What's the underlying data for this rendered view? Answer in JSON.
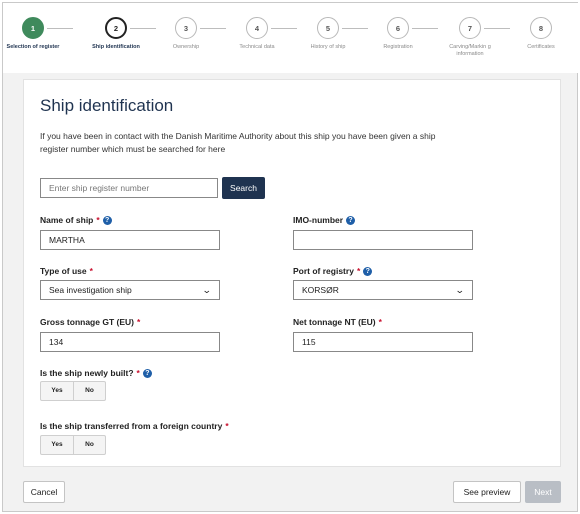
{
  "steps": [
    {
      "number": "1",
      "label": "Selection of register",
      "state": "done"
    },
    {
      "number": "2",
      "label": "Ship identification",
      "state": "active"
    },
    {
      "number": "3",
      "label": "Ownership",
      "state": "pending"
    },
    {
      "number": "4",
      "label": "Technical data",
      "state": "pending"
    },
    {
      "number": "5",
      "label": "History of ship",
      "state": "pending"
    },
    {
      "number": "6",
      "label": "Registration",
      "state": "pending"
    },
    {
      "number": "7",
      "label": "Carving/Markin g information",
      "state": "pending"
    },
    {
      "number": "8",
      "label": "Certificates",
      "state": "pending"
    }
  ],
  "panel": {
    "title": "Ship identification",
    "intro": "If you have been in contact with the Danish Maritime Authority about this ship you have been given a ship register number which must be searched for here"
  },
  "search": {
    "placeholder": "Enter ship register number",
    "button_label": "Search"
  },
  "fields": {
    "name_label": "Name of ship",
    "name_value": "MARTHA",
    "imo_label": "IMO-number",
    "imo_value": "",
    "type_label": "Type of use",
    "type_value": "Sea investigation ship",
    "port_label": "Port of registry",
    "port_value": "KORSØR",
    "gross_label": "Gross tonnage GT (EU)",
    "gross_value": "134",
    "net_label": "Net tonnage NT (EU)",
    "net_value": "115",
    "newly_built_label": "Is the ship newly built?",
    "transferred_label": "Is the ship transferred from a foreign country"
  },
  "yes_no": {
    "yes": "Yes",
    "no": "No"
  },
  "required_mark": "*",
  "footer": {
    "cancel": "Cancel",
    "preview": "See preview",
    "next": "Next"
  },
  "colors": {
    "accent": "#1f3350",
    "done": "#3f8a5c",
    "required": "#c8102e",
    "help": "#1f5fa8"
  }
}
